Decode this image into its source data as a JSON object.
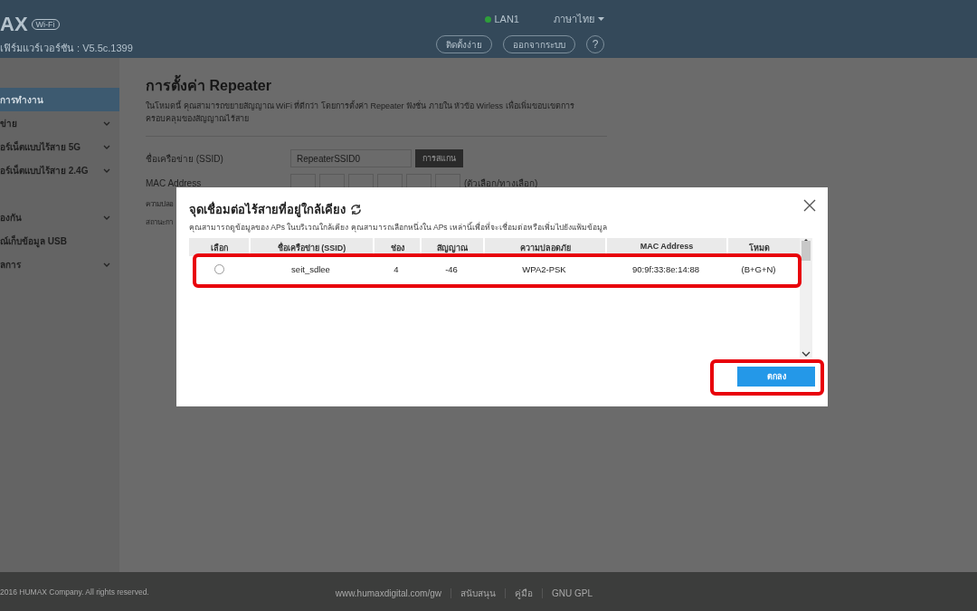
{
  "header": {
    "logo": "AX",
    "logo_badge": "Wi-Fi",
    "firmware": "เฟิร์มแวร์เวอร์ชัน : V5.5c.1399",
    "connection": {
      "label": "LAN1",
      "color": "#2e9e3a"
    },
    "language": "ภาษาไทย",
    "buttons": [
      "ติดตั้งง่าย",
      "ออกจากระบบ"
    ],
    "help": "?"
  },
  "sidebar": {
    "items": [
      {
        "label": "การทำงาน",
        "selected": true,
        "expandable": false
      },
      {
        "label": "ข่าย",
        "selected": false,
        "expandable": true
      },
      {
        "label": "อร์เน็ตแบบไร้สาย 5G",
        "selected": false,
        "expandable": true
      },
      {
        "label": "อร์เน็ตแบบไร้สาย 2.4G",
        "selected": false,
        "expandable": true
      },
      {
        "label": "องกัน",
        "selected": false,
        "expandable": true
      },
      {
        "label": "ณ์เก็บข้อมูล USB",
        "selected": false,
        "expandable": false
      },
      {
        "label": "ลการ",
        "selected": false,
        "expandable": true
      }
    ]
  },
  "main": {
    "title": "การตั้งค่า Repeater",
    "description": "ในโหมดนี้ คุณสามารถขยายสัญญาณ WiFi ที่ดีกว่า โดยการตั้งค่า Repeater ฟังชั่น ภายใน หัวข้อ Wirless เพื่อเพิ่มขอบเขตการครอบคลุมของสัญญาณไร้สาย",
    "ssid_label": "ชื่อเครือข่าย (SSID)",
    "ssid_value": "RepeaterSSID0",
    "scan_button": "การสแกน",
    "mac_label": "MAC Address",
    "mac_hint": "(ตัวเลือก/ทางเลือก)",
    "security_label": "ความปลอ",
    "status_label": "สถานะกา"
  },
  "dialog": {
    "title": "จุดเชื่อมต่อไร้สายที่อยู่ใกล้เคียง",
    "subtitle": "คุณสามารถดูข้อมูลของ APs ในบริเวณใกล้เคียง คุณสามารถเลือกหนึ่งใน APs เหล่านี้เพื่อที่จะเชื่อมต่อหรือเพิ่มไปยังแฟ้มข้อมูล",
    "columns": [
      "เลือก",
      "ชื่อเครือข่าย (SSID)",
      "ช่อง",
      "สัญญาณ",
      "ความปลอดภัย",
      "MAC Address",
      "โหมด"
    ],
    "rows": [
      {
        "selected": false,
        "ssid": "seit_sdlee",
        "channel": "4",
        "signal": "-46",
        "security": "WPA2-PSK",
        "mac": "90:9f:33:8e:14:88",
        "mode": "(B+G+N)",
        "highlighted": true
      }
    ],
    "ok_button": "ตกลง",
    "ok_highlighted": true
  },
  "footer": {
    "copyright": "2016 HUMAX Company. All rights reserved.",
    "links": [
      "www.humaxdigital.com/gw",
      "สนับสนุน",
      "คู่มือ",
      "GNU GPL"
    ]
  }
}
